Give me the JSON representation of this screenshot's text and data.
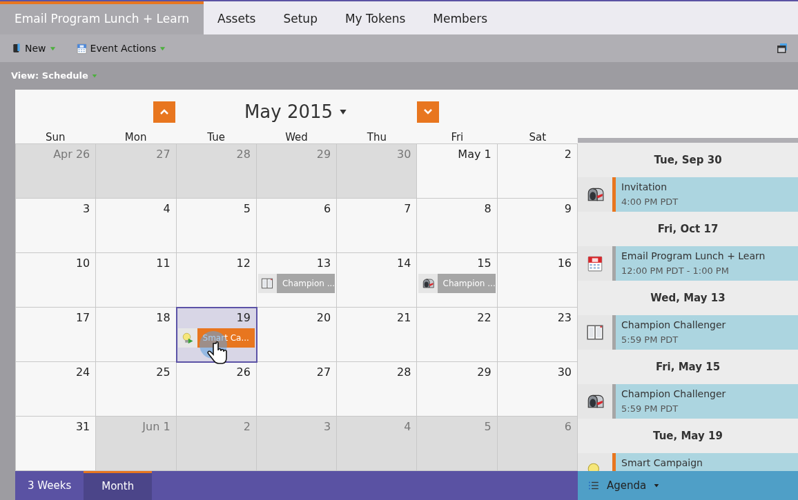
{
  "tabs": [
    {
      "label": "Email Program Lunch + Learn",
      "selected": true
    },
    {
      "label": "Assets",
      "selected": false
    },
    {
      "label": "Setup",
      "selected": false
    },
    {
      "label": "My Tokens",
      "selected": false
    },
    {
      "label": "Members",
      "selected": false
    }
  ],
  "toolbar": [
    {
      "kind": "new",
      "label": "New"
    },
    {
      "kind": "event",
      "label": "Event Actions"
    }
  ],
  "view_menu": {
    "label": "View: Schedule"
  },
  "calendar": {
    "title": "May 2015",
    "weekdays": [
      "Sun",
      "Mon",
      "Tue",
      "Wed",
      "Thu",
      "Fri",
      "Sat"
    ],
    "weeks": [
      [
        {
          "label": "Apr 26",
          "outside": true,
          "selected": false
        },
        {
          "label": "27",
          "outside": true,
          "selected": false
        },
        {
          "label": "28",
          "outside": true,
          "selected": false
        },
        {
          "label": "29",
          "outside": true,
          "selected": false
        },
        {
          "label": "30",
          "outside": true,
          "selected": false
        },
        {
          "label": "May 1",
          "outside": false,
          "selected": false
        },
        {
          "label": "2",
          "outside": false,
          "selected": false
        }
      ],
      [
        {
          "label": "3",
          "outside": false,
          "selected": false
        },
        {
          "label": "4",
          "outside": false,
          "selected": false
        },
        {
          "label": "5",
          "outside": false,
          "selected": false
        },
        {
          "label": "6",
          "outside": false,
          "selected": false
        },
        {
          "label": "7",
          "outside": false,
          "selected": false
        },
        {
          "label": "8",
          "outside": false,
          "selected": false
        },
        {
          "label": "9",
          "outside": false,
          "selected": false
        }
      ],
      [
        {
          "label": "10",
          "outside": false,
          "selected": false
        },
        {
          "label": "11",
          "outside": false,
          "selected": false
        },
        {
          "label": "12",
          "outside": false,
          "selected": false
        },
        {
          "label": "13",
          "outside": false,
          "selected": false,
          "events": [
            {
              "kind": "ab-test",
              "label": "Champion ...",
              "color": "#a6a6a6"
            }
          ]
        },
        {
          "label": "14",
          "outside": false,
          "selected": false
        },
        {
          "label": "15",
          "outside": false,
          "selected": false,
          "events": [
            {
              "kind": "mailbox",
              "label": "Champion ...",
              "color": "#a6a6a6"
            }
          ]
        },
        {
          "label": "16",
          "outside": false,
          "selected": false
        }
      ],
      [
        {
          "label": "17",
          "outside": false,
          "selected": false
        },
        {
          "label": "18",
          "outside": false,
          "selected": false
        },
        {
          "label": "19",
          "outside": false,
          "selected": true,
          "events": [
            {
              "kind": "campaign",
              "label": "Smart Ca...",
              "color": "#e8761f"
            }
          ]
        },
        {
          "label": "20",
          "outside": false,
          "selected": false
        },
        {
          "label": "21",
          "outside": false,
          "selected": false
        },
        {
          "label": "22",
          "outside": false,
          "selected": false
        },
        {
          "label": "23",
          "outside": false,
          "selected": false
        }
      ],
      [
        {
          "label": "24",
          "outside": false,
          "selected": false
        },
        {
          "label": "25",
          "outside": false,
          "selected": false
        },
        {
          "label": "26",
          "outside": false,
          "selected": false
        },
        {
          "label": "27",
          "outside": false,
          "selected": false
        },
        {
          "label": "28",
          "outside": false,
          "selected": false
        },
        {
          "label": "29",
          "outside": false,
          "selected": false
        },
        {
          "label": "30",
          "outside": false,
          "selected": false
        }
      ],
      [
        {
          "label": "31",
          "outside": false,
          "selected": false
        },
        {
          "label": "Jun 1",
          "outside": true,
          "selected": false
        },
        {
          "label": "2",
          "outside": true,
          "selected": false
        },
        {
          "label": "3",
          "outside": true,
          "selected": false
        },
        {
          "label": "4",
          "outside": true,
          "selected": false
        },
        {
          "label": "5",
          "outside": true,
          "selected": false
        },
        {
          "label": "6",
          "outside": true,
          "selected": false
        }
      ]
    ]
  },
  "view_tabs": [
    {
      "label": "3 Weeks",
      "selected": false
    },
    {
      "label": "Month",
      "selected": true
    }
  ],
  "agenda": {
    "groups": [
      {
        "date": "Tue, Sep 30",
        "items": [
          {
            "kind": "mailbox",
            "title": "Invitation",
            "time": "4:00 PM PDT",
            "color": "#e8761f"
          }
        ]
      },
      {
        "date": "Fri, Oct 17",
        "items": [
          {
            "kind": "calendar",
            "title": "Email Program Lunch + Learn",
            "time": "12:00 PM PDT - 1:00 PM",
            "color": "#a6a6a6"
          }
        ]
      },
      {
        "date": "Wed, May 13",
        "items": [
          {
            "kind": "ab-test",
            "title": "Champion Challenger",
            "time": "5:59 PM PDT",
            "color": "#a6a6a6"
          }
        ]
      },
      {
        "date": "Fri, May 15",
        "items": [
          {
            "kind": "mailbox",
            "title": "Champion Challenger",
            "time": "5:59 PM PDT",
            "color": "#a6a6a6"
          }
        ]
      },
      {
        "date": "Tue, May 19",
        "items": [
          {
            "kind": "campaign",
            "title": "Smart Campaign",
            "color": "#e8761f"
          }
        ]
      }
    ],
    "button": {
      "label": "Agenda"
    }
  }
}
